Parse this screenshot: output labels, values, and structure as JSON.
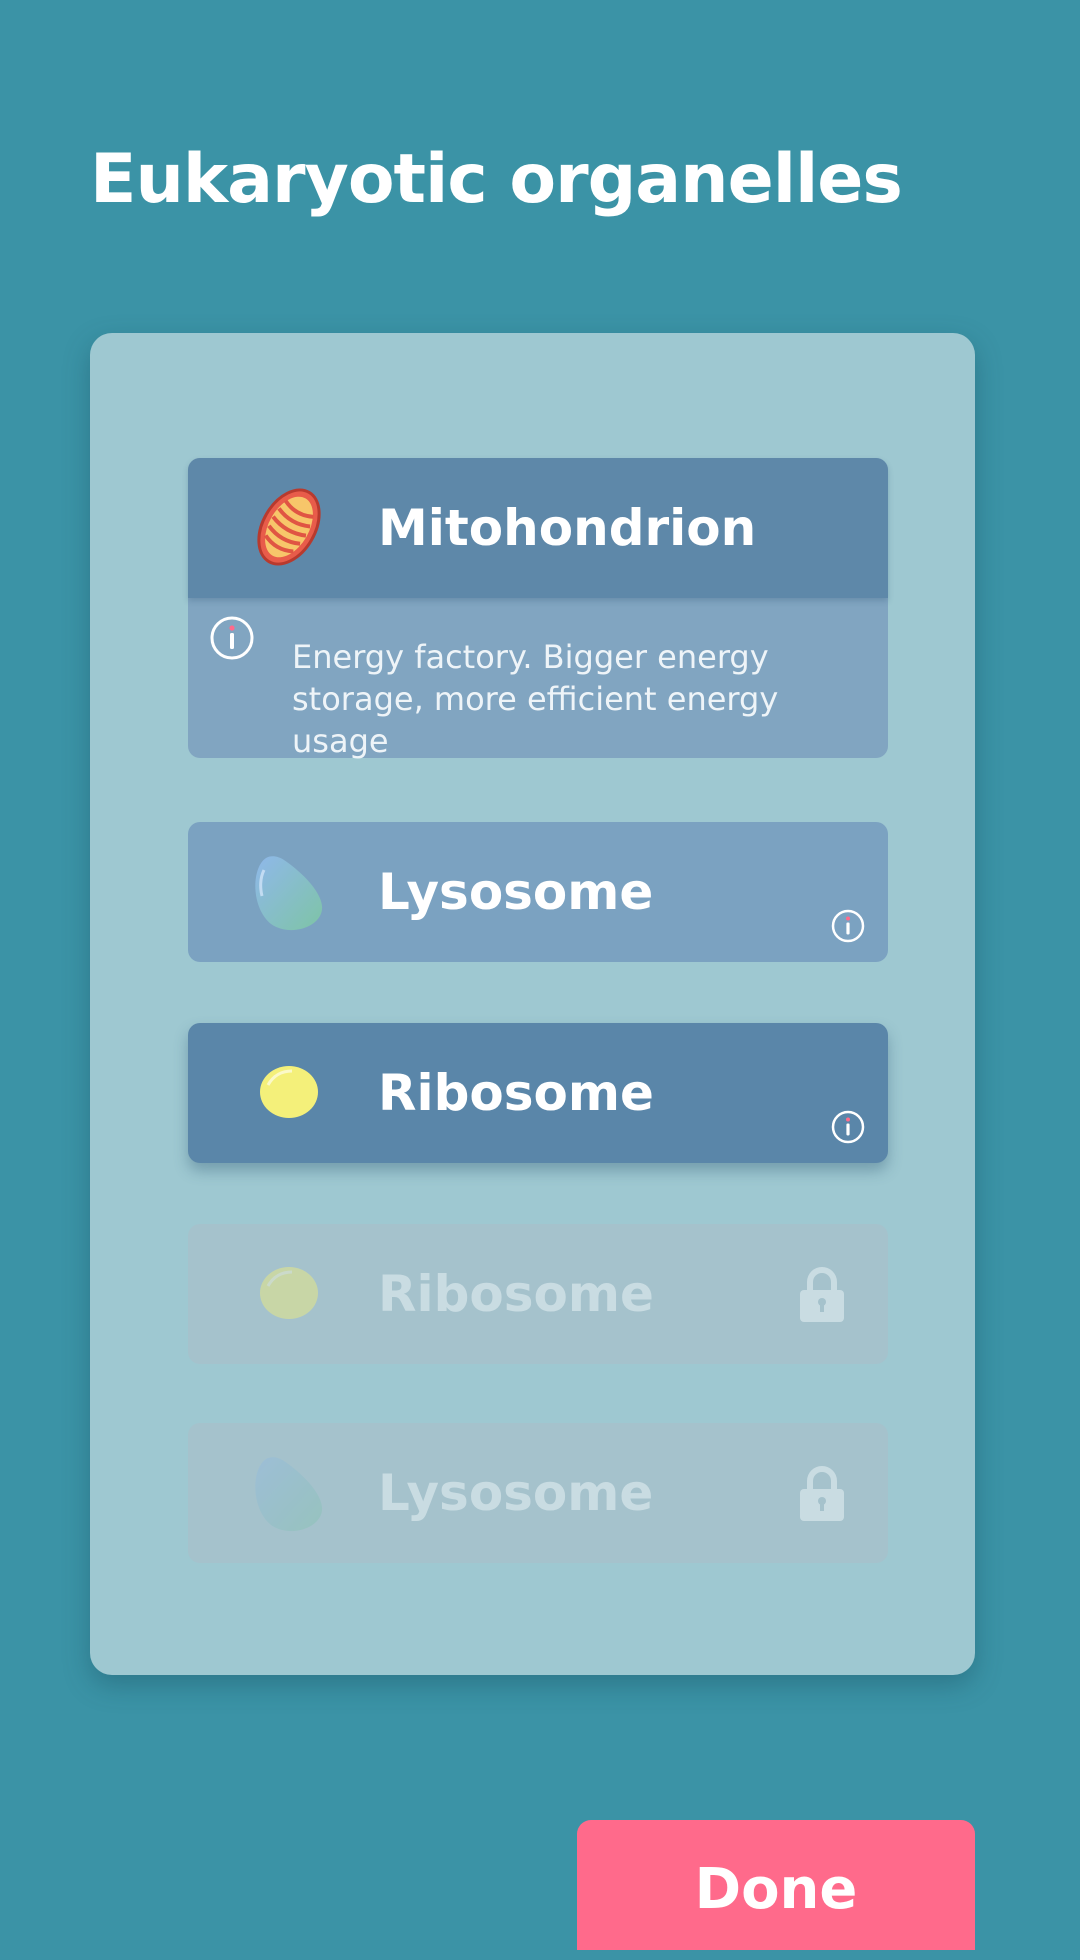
{
  "header": {
    "title": "Eukaryotic organelles"
  },
  "organelles": [
    {
      "name": "Mitohondrion",
      "icon": "mitochondrion-icon",
      "expanded": true,
      "locked": false,
      "description": "Energy factory. Bigger energy storage, more efficient energy usage"
    },
    {
      "name": "Lysosome",
      "icon": "lysosome-icon",
      "expanded": false,
      "locked": false
    },
    {
      "name": "Ribosome",
      "icon": "ribosome-icon",
      "expanded": false,
      "locked": false
    },
    {
      "name": "Ribosome",
      "icon": "ribosome-icon",
      "expanded": false,
      "locked": true
    },
    {
      "name": "Lysosome",
      "icon": "lysosome-icon",
      "expanded": false,
      "locked": true
    }
  ],
  "footer": {
    "done_label": "Done"
  },
  "colors": {
    "background": "#3b93a6",
    "panel": "#9ec8d1",
    "card_selected": "#5a86a9",
    "done_button": "#ff6a8b"
  }
}
